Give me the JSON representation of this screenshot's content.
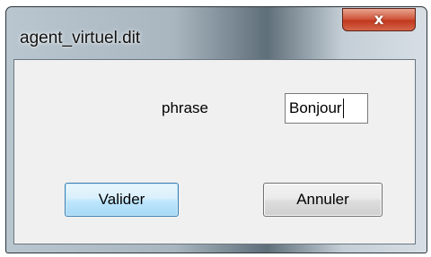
{
  "window": {
    "title": "agent_virtuel.dit",
    "close_glyph": "x"
  },
  "form": {
    "phrase_label": "phrase",
    "phrase_value": "Bonjour"
  },
  "buttons": {
    "validate_label": "Valider",
    "cancel_label": "Annuler"
  },
  "icons": {
    "close": "close-icon"
  },
  "colors": {
    "close_button": "#c1391f",
    "default_button_border": "#3c7fb1",
    "client_background": "#f0f0f0"
  }
}
